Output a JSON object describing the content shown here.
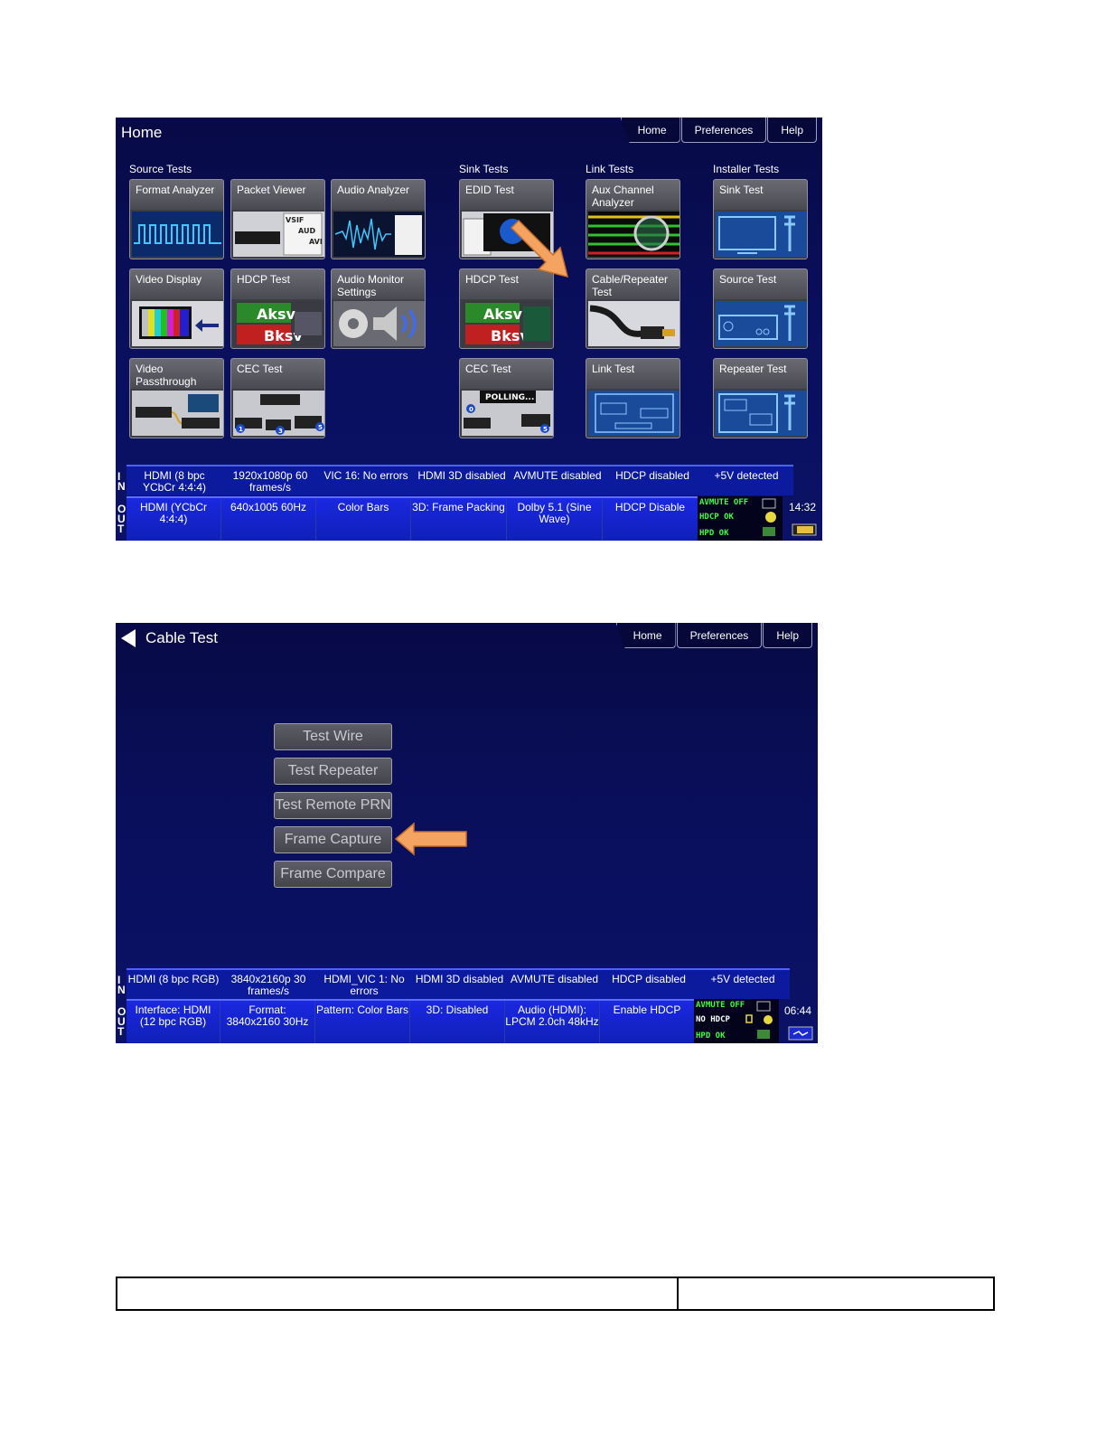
{
  "screen1": {
    "title": "Home",
    "nav": [
      "Home",
      "Preferences",
      "Help"
    ],
    "sections": {
      "source": "Source Tests",
      "sink": "Sink Tests",
      "link": "Link Tests",
      "installer": "Installer Tests"
    },
    "tiles": {
      "format_analyzer": "Format Analyzer",
      "packet_viewer": "Packet Viewer",
      "audio_analyzer": "Audio Analyzer",
      "video_display": "Video Display",
      "hdcp_test_source": "HDCP Test",
      "audio_monitor": "Audio Monitor Settings",
      "video_passthrough": "Video Passthrough",
      "cec_test_source": "CEC Test",
      "edid_test": "EDID Test",
      "hdcp_test_sink": "HDCP Test",
      "cec_test_sink": "CEC Test",
      "aux_channel": "Aux Channel Analyzer",
      "cable_repeater": "Cable/Repeater Test",
      "link_test": "Link Test",
      "sink_test": "Sink Test",
      "source_test": "Source Test",
      "repeater_test": "Repeater Test"
    },
    "tile_art": {
      "vsif": "VSIF",
      "aud": "AUD",
      "avi": "AVI",
      "aksv": "Aksv",
      "bksv": "Bksv",
      "polling": "POLLING...",
      "port0": "0",
      "port1": "1",
      "port3": "3",
      "port5": "5"
    },
    "in_row": [
      "HDMI (8 bpc YCbCr 4:4:4)",
      "1920x1080p 60 frames/s",
      "VIC 16: No errors",
      "HDMI 3D disabled",
      "AVMUTE disabled",
      "HDCP disabled",
      "+5V detected"
    ],
    "out_row": [
      "HDMI (YCbCr 4:4:4)",
      "640x1005 60Hz",
      "Color Bars",
      "3D: Frame Packing",
      "Dolby 5.1 (Sine Wave)",
      "HDCP Disable"
    ],
    "indicators": [
      "AVMUTE OFF",
      "HDCP OK",
      "HPD OK"
    ],
    "clock": "14:32",
    "io_in": "IN",
    "io_out": "OUT"
  },
  "screen2": {
    "title": "Cable Test",
    "nav": [
      "Home",
      "Preferences",
      "Help"
    ],
    "buttons": [
      "Test Wire",
      "Test Repeater",
      "Test Remote PRN",
      "Frame Capture",
      "Frame Compare"
    ],
    "in_row": [
      "HDMI (8 bpc RGB)",
      "3840x2160p 30 frames/s",
      "HDMI_VIC 1: No errors",
      "HDMI 3D disabled",
      "AVMUTE disabled",
      "HDCP disabled",
      "+5V detected"
    ],
    "out_row": [
      "Interface: HDMI (12 bpc RGB)",
      "Format: 3840x2160 30Hz",
      "Pattern: Color Bars",
      "3D: Disabled",
      "Audio (HDMI): LPCM 2.0ch 48kHz",
      "Enable HDCP"
    ],
    "indicators": [
      "AVMUTE OFF",
      "NO HDCP",
      "HPD OK"
    ],
    "clock": "06:44",
    "io_in": "IN",
    "io_out": "OUT"
  },
  "colors": {
    "accent_arrow": "#f4a460",
    "status_green": "#3cff3c",
    "screen_bg": "#0a0f5c"
  }
}
